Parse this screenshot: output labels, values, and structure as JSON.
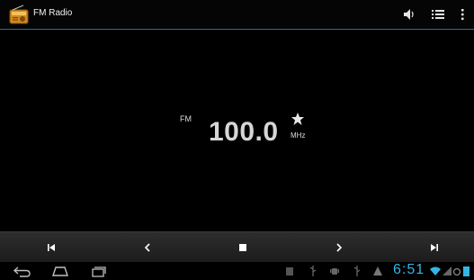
{
  "app": {
    "title": "FM Radio"
  },
  "tuner": {
    "band": "FM",
    "frequency": "100.0",
    "unit": "MHz"
  },
  "status_bar": {
    "time": "6:51"
  },
  "icons": {
    "app": "radio-icon",
    "volume": "speaker-icon",
    "list": "list-icon",
    "overflow": "overflow-menu-icon",
    "favorite": "star-icon",
    "prev_station": "skip-previous-icon",
    "seek_down": "chevron-left-icon",
    "stop": "stop-icon",
    "seek_up": "chevron-right-icon",
    "next_station": "skip-next-icon",
    "back": "back-icon",
    "home": "home-icon",
    "recents": "recents-icon"
  },
  "colors": {
    "accent": "#33b5e5",
    "background": "#000000",
    "divider": "#2a6f95"
  }
}
